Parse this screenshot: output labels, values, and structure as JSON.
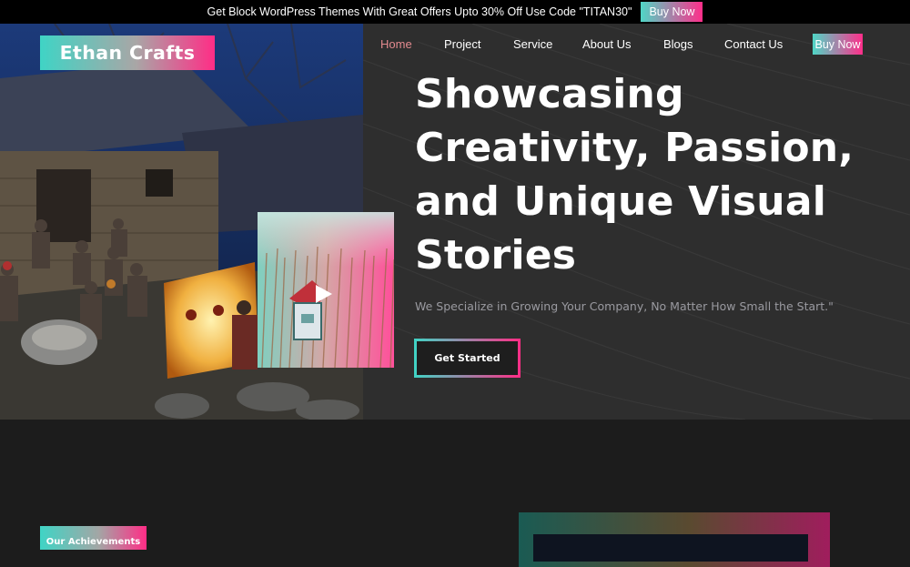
{
  "promo": {
    "text": "Get Block WordPress Themes With Great Offers Upto 30% Off Use Code \"TITAN30\"",
    "button": "Buy Now"
  },
  "logo": "Ethan Crafts",
  "nav": {
    "items": [
      "Home",
      "Project",
      "Service",
      "About Us",
      "Blogs",
      "Contact Us"
    ],
    "active": "Home",
    "buy_button": "Buy Now"
  },
  "hero": {
    "headline_lines": [
      "Showcasing",
      "Creativity, Passion,",
      "and Unique Visual",
      "Stories"
    ],
    "subtext": "We Specialize in Growing Your Company, No Matter How Small the Start.\"",
    "cta": "Get Started"
  },
  "achievements": {
    "badge": "Our Achievements"
  },
  "colors": {
    "gradient_start": "#3fd4c5",
    "gradient_end": "#ff2d86",
    "hero_bg": "#2e2e2e",
    "page_bg": "#1c1c1c",
    "nav_active": "#e38a8f"
  },
  "icons": [
    "play-icon"
  ]
}
